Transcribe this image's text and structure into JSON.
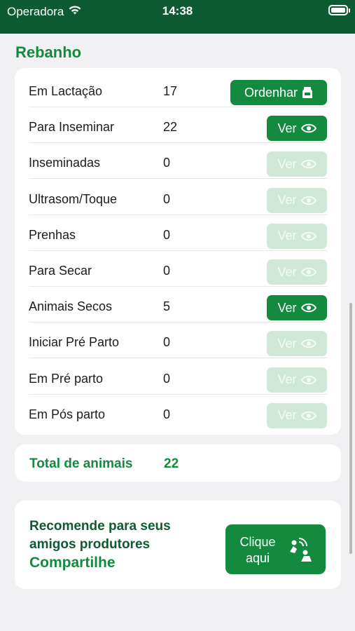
{
  "status_bar": {
    "carrier": "Operadora",
    "time": "14:38"
  },
  "section": {
    "title": "Rebanho"
  },
  "herd": {
    "rows": [
      {
        "label": "Em Lactação",
        "count": "17",
        "button": "Ordenhar",
        "button_type": "ordenar",
        "enabled": true
      },
      {
        "label": "Para Inseminar",
        "count": "22",
        "button": "Ver",
        "button_type": "ver",
        "enabled": true
      },
      {
        "label": "Inseminadas",
        "count": "0",
        "button": "Ver",
        "button_type": "ver",
        "enabled": false
      },
      {
        "label": "Ultrasom/Toque",
        "count": "0",
        "button": "Ver",
        "button_type": "ver",
        "enabled": false
      },
      {
        "label": "Prenhas",
        "count": "0",
        "button": "Ver",
        "button_type": "ver",
        "enabled": false
      },
      {
        "label": "Para Secar",
        "count": "0",
        "button": "Ver",
        "button_type": "ver",
        "enabled": false
      },
      {
        "label": "Animais Secos",
        "count": "5",
        "button": "Ver",
        "button_type": "ver",
        "enabled": true
      },
      {
        "label": "Iniciar Pré Parto",
        "count": "0",
        "button": "Ver",
        "button_type": "ver",
        "enabled": false
      },
      {
        "label": "Em Pré parto",
        "count": "0",
        "button": "Ver",
        "button_type": "ver",
        "enabled": false
      },
      {
        "label": "Em Pós parto",
        "count": "0",
        "button": "Ver",
        "button_type": "ver",
        "enabled": false
      }
    ]
  },
  "total": {
    "label": "Total de animais",
    "count": "22"
  },
  "share": {
    "line1": "Recomende para seus",
    "line2": "amigos produtores",
    "line3": "Compartilhe",
    "button_line1": "Clique",
    "button_line2": "aqui"
  },
  "colors": {
    "header_bg": "#0e5a32",
    "accent": "#138a3e",
    "disabled_button": "#cfe8d8",
    "background": "#f1f1f3"
  },
  "icons": {
    "wifi": "wifi-icon",
    "battery": "battery-icon",
    "eye": "eye-icon",
    "milk": "milk-icon",
    "share": "share-icon"
  }
}
